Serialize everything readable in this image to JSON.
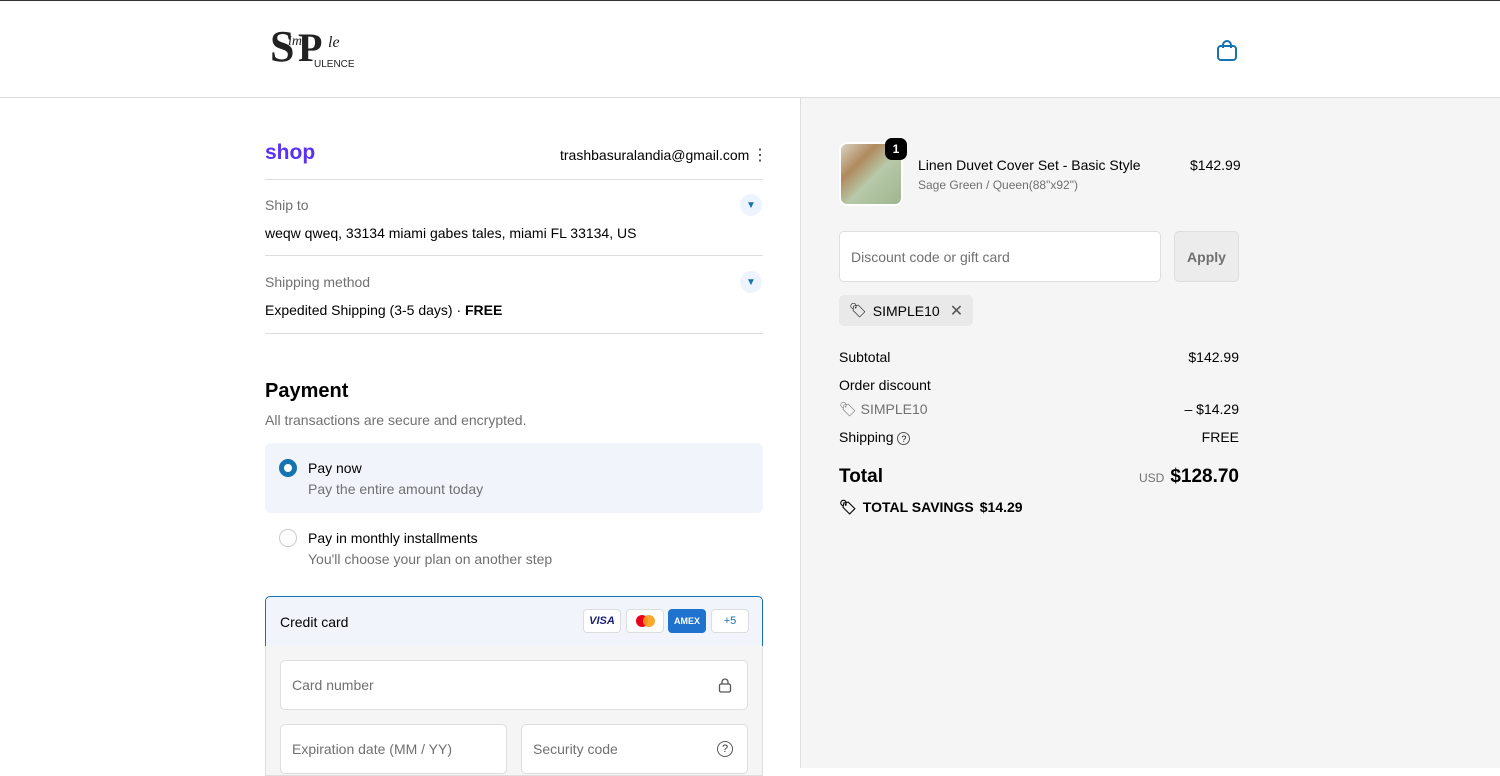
{
  "header": {
    "logo_text": "Simple Opulence",
    "cart_icon": "shopping-bag-icon"
  },
  "account": {
    "shop_label": "shop",
    "email": "trashbasuralandia@gmail.com"
  },
  "ship_to": {
    "label": "Ship to",
    "value": "weqw qweq, 33134 miami gabes tales, miami FL 33134, US"
  },
  "shipping_method": {
    "label": "Shipping method",
    "value": "Expedited Shipping (3-5 days) · ",
    "price": "FREE"
  },
  "payment": {
    "title": "Payment",
    "subtitle": "All transactions are secure and encrypted.",
    "options": [
      {
        "title": "Pay now",
        "subtitle": "Pay the entire amount today",
        "selected": true
      },
      {
        "title": "Pay in monthly installments",
        "subtitle": "You'll choose your plan on another step",
        "selected": false
      }
    ],
    "credit_card": {
      "label": "Credit card",
      "brands": [
        "VISA",
        "Mastercard",
        "AMEX"
      ],
      "more": "+5",
      "card_number_placeholder": "Card number",
      "expiry_placeholder": "Expiration date (MM / YY)",
      "security_placeholder": "Security code"
    }
  },
  "summary": {
    "item": {
      "name": "Linen Duvet Cover Set - Basic Style",
      "variant": "Sage Green / Queen(88\"x92\")",
      "price": "$142.99",
      "quantity": "1"
    },
    "discount_placeholder": "Discount code or gift card",
    "apply": "Apply",
    "applied_code": "SIMPLE10",
    "subtotal_label": "Subtotal",
    "subtotal": "$142.99",
    "order_discount_label": "Order discount",
    "discount_code": "SIMPLE10",
    "discount_amount": "– $14.29",
    "shipping_label": "Shipping",
    "shipping": "FREE",
    "total_label": "Total",
    "currency": "USD",
    "total": "$128.70",
    "savings_label": "TOTAL SAVINGS",
    "savings": "$14.29"
  }
}
